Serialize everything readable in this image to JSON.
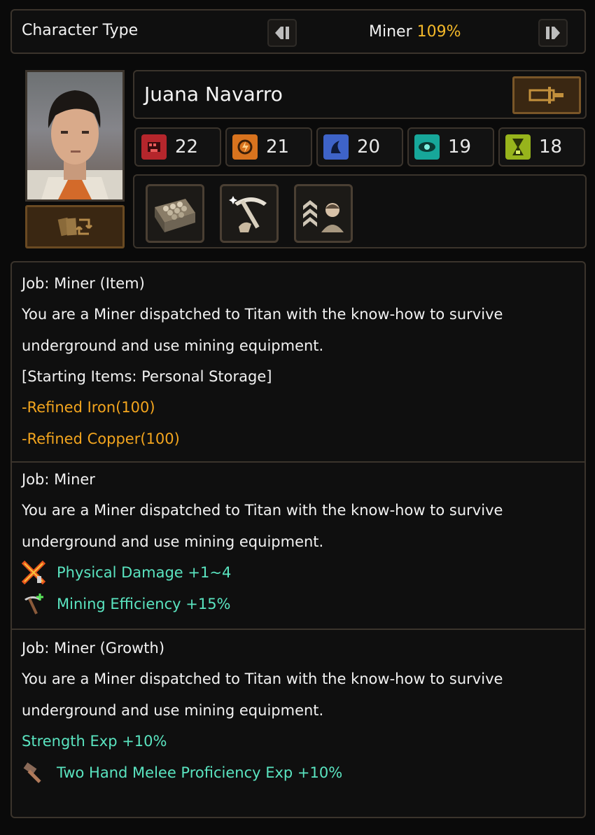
{
  "header": {
    "title": "Character Type",
    "job_name": "Miner",
    "job_percent": "109%"
  },
  "character": {
    "name": "Juana Navarro"
  },
  "stats": [
    {
      "icon": "strength-fist-icon",
      "value": "22",
      "color": "#b5262c"
    },
    {
      "icon": "dexterity-icon",
      "value": "21",
      "color": "#d8731e"
    },
    {
      "icon": "intelligence-icon",
      "value": "20",
      "color": "#3e63c8"
    },
    {
      "icon": "perception-eye-icon",
      "value": "19",
      "color": "#17a79a"
    },
    {
      "icon": "endurance-hourglass-icon",
      "value": "18",
      "color": "#97b41c"
    }
  ],
  "skills": [
    {
      "icon": "ore-crate-icon"
    },
    {
      "icon": "pickaxe-skill-icon"
    },
    {
      "icon": "rank-up-worker-icon"
    }
  ],
  "sections": [
    {
      "title": "Job: Miner (Item)",
      "desc_line1": "You are a Miner dispatched to Titan with the know-how to survive",
      "desc_line2": "underground and use mining equipment.",
      "items_header": "[Starting Items: Personal Storage]",
      "item1": "-Refined Iron(100)",
      "item2": "-Refined Copper(100)"
    },
    {
      "title": "Job: Miner",
      "desc_line1": "You are a Miner dispatched to Titan with the know-how to survive",
      "desc_line2": "underground and use mining equipment.",
      "bonus1": "Physical Damage +1~4",
      "bonus2": "Mining Efficiency +15%"
    },
    {
      "title": "Job: Miner (Growth)",
      "desc_line1": "You are a Miner dispatched to Titan with the know-how to survive",
      "desc_line2": "underground and use mining equipment.",
      "bonus1": "Strength Exp +10%",
      "bonus2": "Two Hand Melee Proficiency Exp +10%"
    }
  ],
  "colors": {
    "accent_orange": "#f3a51e",
    "bonus_teal": "#5ae4c0",
    "percent_yellow": "#f3b829",
    "border": "#3b342c"
  }
}
